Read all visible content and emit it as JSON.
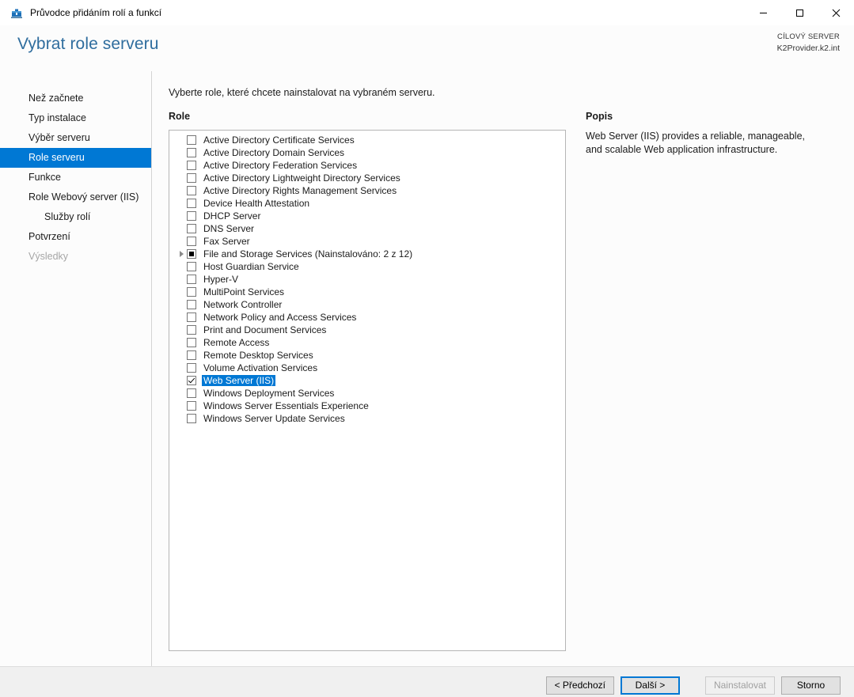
{
  "window": {
    "title": "Průvodce přidáním rolí a funkcí",
    "icon": "server-toolbox-icon",
    "controls": {
      "minimize": "minimize-icon",
      "maximize": "maximize-icon",
      "close": "close-icon"
    }
  },
  "header": {
    "page_title": "Vybrat role serveru",
    "target_server_label": "CÍLOVÝ SERVER",
    "target_server_name": "K2Provider.k2.int"
  },
  "sidebar": {
    "items": [
      {
        "label": "Než začnete",
        "state": "normal"
      },
      {
        "label": "Typ instalace",
        "state": "normal"
      },
      {
        "label": "Výběr serveru",
        "state": "normal"
      },
      {
        "label": "Role serveru",
        "state": "selected"
      },
      {
        "label": "Funkce",
        "state": "normal"
      },
      {
        "label": "Role Webový server (IIS)",
        "state": "normal"
      },
      {
        "label": "Služby rolí",
        "state": "sub"
      },
      {
        "label": "Potvrzení",
        "state": "normal"
      },
      {
        "label": "Výsledky",
        "state": "disabled"
      }
    ]
  },
  "main": {
    "instruction": "Vyberte role, které chcete nainstalovat na vybraném serveru.",
    "roles_label": "Role",
    "description_label": "Popis",
    "description_text": "Web Server (IIS) provides a reliable, manageable, and scalable Web application infrastructure.",
    "roles": [
      {
        "label": "Active Directory Certificate Services",
        "checked": false,
        "partial": false,
        "expandable": false,
        "selected": false
      },
      {
        "label": "Active Directory Domain Services",
        "checked": false,
        "partial": false,
        "expandable": false,
        "selected": false
      },
      {
        "label": "Active Directory Federation Services",
        "checked": false,
        "partial": false,
        "expandable": false,
        "selected": false
      },
      {
        "label": "Active Directory Lightweight Directory Services",
        "checked": false,
        "partial": false,
        "expandable": false,
        "selected": false
      },
      {
        "label": "Active Directory Rights Management Services",
        "checked": false,
        "partial": false,
        "expandable": false,
        "selected": false
      },
      {
        "label": "Device Health Attestation",
        "checked": false,
        "partial": false,
        "expandable": false,
        "selected": false
      },
      {
        "label": "DHCP Server",
        "checked": false,
        "partial": false,
        "expandable": false,
        "selected": false
      },
      {
        "label": "DNS Server",
        "checked": false,
        "partial": false,
        "expandable": false,
        "selected": false
      },
      {
        "label": "Fax Server",
        "checked": false,
        "partial": false,
        "expandable": false,
        "selected": false
      },
      {
        "label": "File and Storage Services (Nainstalováno: 2 z 12)",
        "checked": false,
        "partial": true,
        "expandable": true,
        "selected": false
      },
      {
        "label": "Host Guardian Service",
        "checked": false,
        "partial": false,
        "expandable": false,
        "selected": false
      },
      {
        "label": "Hyper-V",
        "checked": false,
        "partial": false,
        "expandable": false,
        "selected": false
      },
      {
        "label": "MultiPoint Services",
        "checked": false,
        "partial": false,
        "expandable": false,
        "selected": false
      },
      {
        "label": "Network Controller",
        "checked": false,
        "partial": false,
        "expandable": false,
        "selected": false
      },
      {
        "label": "Network Policy and Access Services",
        "checked": false,
        "partial": false,
        "expandable": false,
        "selected": false
      },
      {
        "label": "Print and Document Services",
        "checked": false,
        "partial": false,
        "expandable": false,
        "selected": false
      },
      {
        "label": "Remote Access",
        "checked": false,
        "partial": false,
        "expandable": false,
        "selected": false
      },
      {
        "label": "Remote Desktop Services",
        "checked": false,
        "partial": false,
        "expandable": false,
        "selected": false
      },
      {
        "label": "Volume Activation Services",
        "checked": false,
        "partial": false,
        "expandable": false,
        "selected": false
      },
      {
        "label": "Web Server (IIS)",
        "checked": true,
        "partial": false,
        "expandable": false,
        "selected": true
      },
      {
        "label": "Windows Deployment Services",
        "checked": false,
        "partial": false,
        "expandable": false,
        "selected": false
      },
      {
        "label": "Windows Server Essentials Experience",
        "checked": false,
        "partial": false,
        "expandable": false,
        "selected": false
      },
      {
        "label": "Windows Server Update Services",
        "checked": false,
        "partial": false,
        "expandable": false,
        "selected": false
      }
    ]
  },
  "footer": {
    "buttons": [
      {
        "label": "< Předchozí",
        "state": "normal"
      },
      {
        "label": "Další >",
        "state": "focus"
      },
      {
        "label": "Nainstalovat",
        "state": "disabled"
      },
      {
        "label": "Storno",
        "state": "normal"
      }
    ]
  },
  "colors": {
    "accent": "#0078d4",
    "title_blue": "#2f6d9e",
    "body_bg": "#fcfcfc",
    "footer_bg": "#f0f0f0"
  }
}
